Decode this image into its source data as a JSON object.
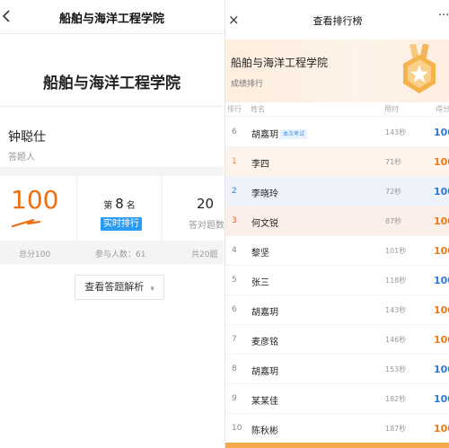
{
  "left": {
    "header_title": "船舶与海洋工程学院",
    "banner_title": "船舶与海洋工程学院",
    "user_name": "钟聪仕",
    "user_role": "答题人",
    "score": "100",
    "rank_prefix": "第",
    "rank": "8",
    "rank_suffix": "名",
    "realtime_label": "实时排行",
    "correct_count": "20",
    "correct_label": "答对题数",
    "footer": {
      "total_score": "总分100",
      "participants": "参与人数：61",
      "total_questions": "共20题"
    },
    "analysis_button": "查看答题解析",
    "analysis_chevron": "»"
  },
  "right": {
    "close_icon": "×",
    "header_title": "查看排行榜",
    "more_icon": "···",
    "banner_title": "船舶与海洋工程学院",
    "banner_subtitle": "成绩排行",
    "columns": {
      "rank": "排行",
      "name": "姓名",
      "time": "用时",
      "score": "得分"
    },
    "current_tag": "本次考试",
    "rows": [
      {
        "rank": "6",
        "name": "胡嘉玥",
        "time": "143秒",
        "score": "100"
      },
      {
        "rank": "1",
        "name": "李四",
        "time": "71秒",
        "score": "100"
      },
      {
        "rank": "2",
        "name": "李晓玲",
        "time": "72秒",
        "score": "100"
      },
      {
        "rank": "3",
        "name": "何文锐",
        "time": "87秒",
        "score": "100"
      },
      {
        "rank": "4",
        "name": "黎坚",
        "time": "101秒",
        "score": "100"
      },
      {
        "rank": "5",
        "name": "张三",
        "time": "118秒",
        "score": "100"
      },
      {
        "rank": "6",
        "name": "胡嘉玥",
        "time": "143秒",
        "score": "100"
      },
      {
        "rank": "7",
        "name": "麦彦铭",
        "time": "146秒",
        "score": "100"
      },
      {
        "rank": "8",
        "name": "胡嘉玥",
        "time": "153秒",
        "score": "100"
      },
      {
        "rank": "9",
        "name": "某某佳",
        "time": "182秒",
        "score": "100"
      },
      {
        "rank": "10",
        "name": "陈秋彬",
        "time": "187秒",
        "score": "100"
      }
    ]
  },
  "colors": {
    "accent_orange": "#ee6f10",
    "accent_blue": "#2a9cf4",
    "rank1": "#e08a2a",
    "rank2": "#3f7ed8",
    "rank3": "#e05a3a"
  }
}
